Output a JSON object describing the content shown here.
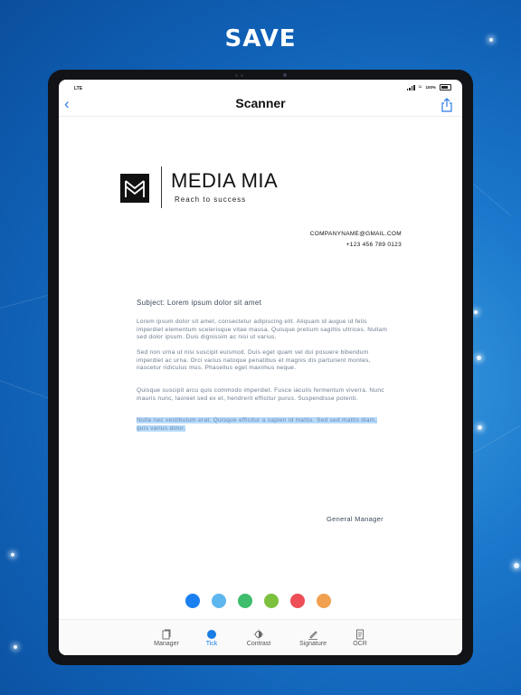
{
  "headline": "SAVE",
  "status": {
    "carrier": "LTE",
    "battery": "100%"
  },
  "nav": {
    "title": "Scanner"
  },
  "document": {
    "company": "MEDIA MIA",
    "tagline": "Reach to success",
    "email": "COMPANYNAME@GMAIL.COM",
    "phone": "+123 456 789 0123",
    "subject": "Subject: Lorem ipsum dolor sit amet",
    "paragraphs": [
      "Lorem ipsum dolor sit amet, consectetur adipiscing elit. Aliquam id augue id felis imperdiet elementum scelerisque vitae massa. Quisque pretium sagittis ultrices. Nullam sed dolor ipsum. Duis dignissim ac nisi ut varius.",
      "Sed non urna ut nisi suscipit euismod. Duis eget quam vel dui posuere bibendum imperdiet ac urna. Orci varius natoque penatibus et magnis dis parturient montes, nascetur ridiculus mus. Phasellus eget maximus neque.",
      "Quisque suscipit arcu quis commodo imperdiet. Fusce iaculis fermentum viverra. Nunc mauris nunc, laoreet sed ex et, hendrerit efficitur purus. Suspendisse potenti."
    ],
    "highlighted": "Nulla nec vestibulum erat. Quisque efficitur a sapien id mattis. Sed sed mattis diam, quis varius dolor.",
    "signature": "General Manager"
  },
  "colors": {
    "swatches": [
      "#1a7ff0",
      "#5db6ee",
      "#3ebd6c",
      "#7cc13e",
      "#ee4e55",
      "#f0a04f"
    ],
    "accent": "#1a7de6"
  },
  "toolbar": {
    "items": [
      {
        "label": "Manager",
        "icon": "document-stack-icon"
      },
      {
        "label": "Tick",
        "icon": "dot-icon"
      },
      {
        "label": "Contrast",
        "icon": "contrast-icon"
      },
      {
        "label": "Signature",
        "icon": "pen-icon"
      },
      {
        "label": "OCR",
        "icon": "ocr-doc-icon"
      }
    ]
  }
}
